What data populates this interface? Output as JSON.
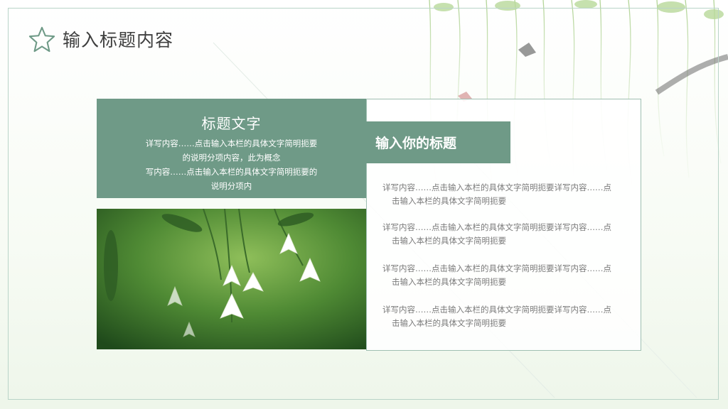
{
  "header": {
    "title": "输入标题内容",
    "icon": "star-outline-icon"
  },
  "left_box": {
    "title": "标题文字",
    "lines": [
      "详写内容……点击输入本栏的具体文字简明扼要",
      "的说明分项内容，此为概念",
      "写内容……点击输入本栏的具体文字简明扼要的",
      "说明分项内"
    ]
  },
  "right_panel": {
    "subtitle": "输入你的标题",
    "paragraphs": [
      [
        "详写内容……点击输入本栏的具体文字简明扼要详写内容……点",
        "击输入本栏的具体文字简明扼要"
      ],
      [
        "详写内容……点击输入本栏的具体文字简明扼要详写内容……点",
        "击输入本栏的具体文字简明扼要"
      ],
      [
        "详写内容……点击输入本栏的具体文字简明扼要详写内容……点",
        "击输入本栏的具体文字简明扼要"
      ],
      [
        "详写内容……点击输入本栏的具体文字简明扼要详写内容……点",
        "击输入本栏的具体文字简明扼要"
      ]
    ]
  },
  "colors": {
    "accent": "#6f9a87",
    "border": "#9fbfb2",
    "text": "#7a7a7a",
    "title": "#3e3e3e"
  }
}
